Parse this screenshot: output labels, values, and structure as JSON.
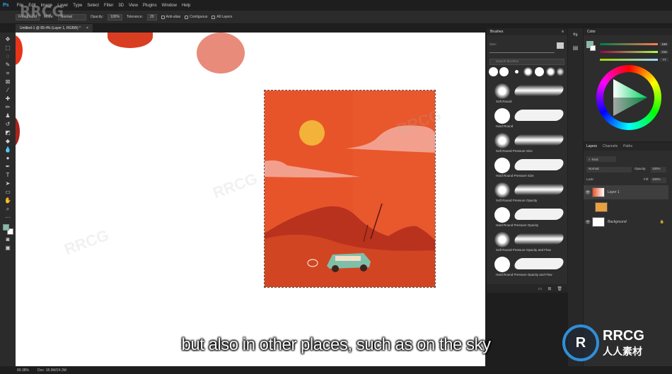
{
  "menubar": {
    "items": [
      "File",
      "Edit",
      "Image",
      "Layer",
      "Type",
      "Select",
      "Filter",
      "3D",
      "View",
      "Plugins",
      "Window",
      "Help"
    ]
  },
  "options": {
    "mode_label": "Mode:",
    "mode_value": "Normal",
    "opacity_label": "Opacity:",
    "opacity_value": "100%",
    "tolerance_label": "Tolerance:",
    "tolerance_value": "20",
    "anti_alias": "Anti-alias",
    "contiguous": "Contiguous",
    "all_layers": "All Layers",
    "fill_source": "Foreground"
  },
  "document": {
    "tab_title": "Untitled-1 @ 89.4% (Layer 1, RGB/8) *"
  },
  "brushes": {
    "title": "Brushes",
    "size_label": "Size:",
    "search_placeholder": "Search Brushes",
    "items": [
      {
        "name": "Soft Round",
        "soft": true
      },
      {
        "name": "Hard Round",
        "soft": false
      },
      {
        "name": "Soft Round Pressure Size",
        "soft": true
      },
      {
        "name": "Hard Round Pressure Size",
        "soft": false
      },
      {
        "name": "Soft Round Pressure Opacity",
        "soft": true
      },
      {
        "name": "Hard Round Pressure Opacity",
        "soft": false
      },
      {
        "name": "Soft Round Pressure Opacity and Flow",
        "soft": true
      },
      {
        "name": "Hard Round Pressure Opacity and Flow",
        "soft": false
      }
    ]
  },
  "color": {
    "title": "Color",
    "r": "159",
    "g": "215",
    "b": "77",
    "foreground": "#7fbfa8",
    "background": "#ffffff"
  },
  "layers": {
    "tabs": [
      "Layers",
      "Channels",
      "Paths"
    ],
    "kind_label": "Kind",
    "blend_mode": "Normal",
    "opacity_label": "Opacity:",
    "opacity_value": "100%",
    "lock_label": "Lock:",
    "fill_label": "Fill:",
    "fill_value": "100%",
    "items": [
      {
        "name": "Layer 1",
        "selected": true
      },
      {
        "name": "",
        "selected": false
      },
      {
        "name": "Background",
        "selected": false
      }
    ]
  },
  "status": {
    "zoom": "89.38%",
    "doc_info": "Doc: 18.9M/24.3M"
  },
  "overlay": {
    "subtitle": "but also in other places, such as on the sky",
    "watermark": "RRCG",
    "logo_title": "RRCG",
    "logo_subtitle": "人人素材"
  }
}
